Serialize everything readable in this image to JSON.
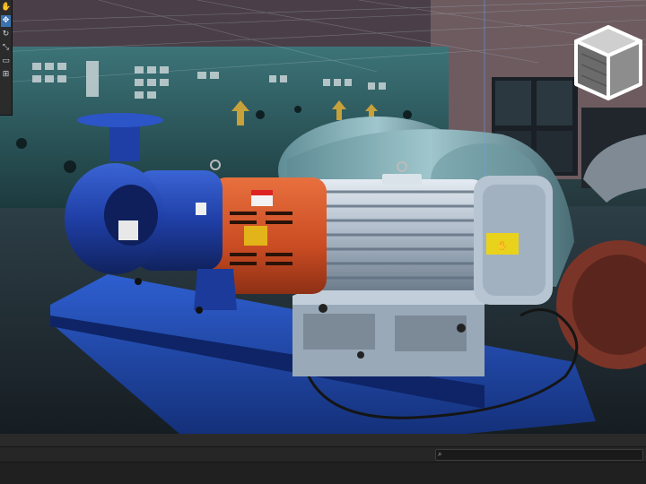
{
  "tools": [
    {
      "icon": "hand-tool-icon",
      "glyph": "✋",
      "active": false
    },
    {
      "icon": "move-tool-icon",
      "glyph": "✥",
      "active": true
    },
    {
      "icon": "rotate-tool-icon",
      "glyph": "↻",
      "active": false
    },
    {
      "icon": "scale-tool-icon",
      "glyph": "⤡",
      "active": false
    },
    {
      "icon": "rect-tool-icon",
      "glyph": "▭",
      "active": false
    },
    {
      "icon": "transform-tool-icon",
      "glyph": "⊞",
      "active": false
    }
  ],
  "search": {
    "placeholder": "",
    "icon": "search-icon",
    "glyph": "⌕"
  },
  "colors": {
    "pump_blue": "#1f3fa6",
    "coupling_orange": "#d4542a",
    "motor_grey": "#c5d0db",
    "wall_teal": "#2b5c60",
    "turbine_teal": "#8fb6be",
    "gizmo_grey": "#9a9a9a"
  }
}
